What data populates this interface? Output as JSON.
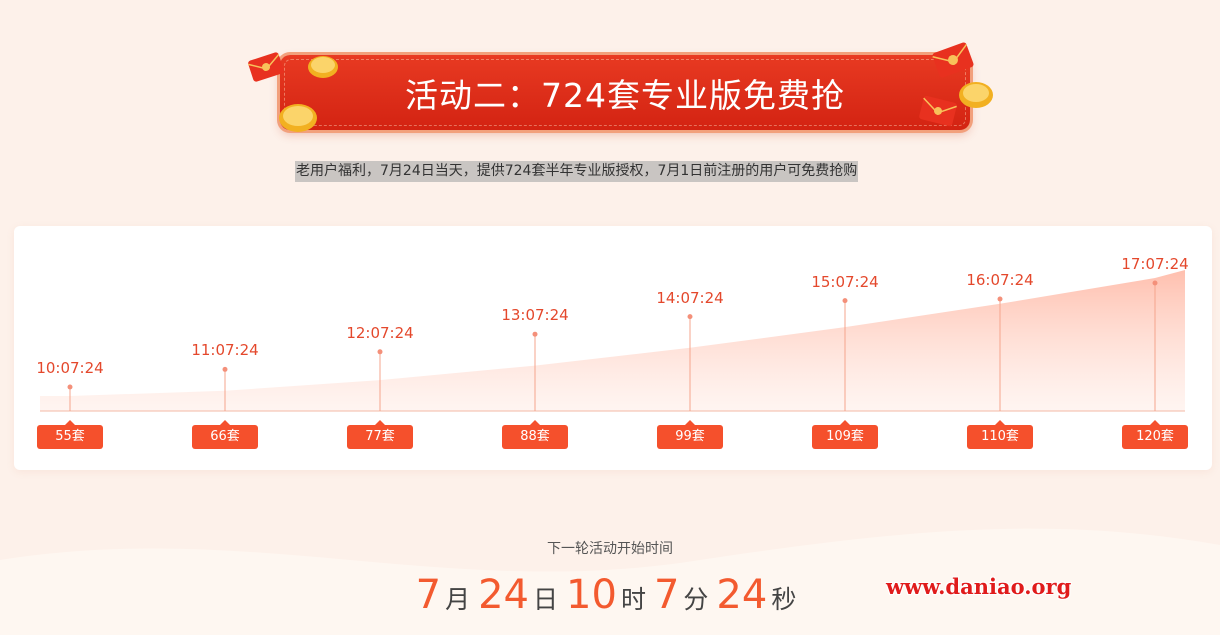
{
  "banner": {
    "title": "活动二：724套专业版免费抢"
  },
  "subtitle": "老用户福利，7月24日当天，提供724套半年专业版授权，7月1日前注册的用户可免费抢购",
  "icons": [
    "red-envelope-icon",
    "gold-coin-icon",
    "red-envelope-icon",
    "gold-coin-icon",
    "red-envelope-icon",
    "gold-coin-icon"
  ],
  "colors": {
    "accent": "#f5502c",
    "banner": "#d32312",
    "time_text": "#e4482c",
    "background": "#fdf1ea"
  },
  "chart_data": {
    "type": "area",
    "categories": [
      "10:07:24",
      "11:07:24",
      "12:07:24",
      "13:07:24",
      "14:07:24",
      "15:07:24",
      "16:07:24",
      "17:07:24"
    ],
    "values": [
      55,
      66,
      77,
      88,
      99,
      109,
      110,
      120
    ],
    "value_labels": [
      "55套",
      "66套",
      "77套",
      "88套",
      "99套",
      "109套",
      "110套",
      "120套"
    ],
    "unit": "套",
    "ylim": [
      0,
      130
    ],
    "grid": false
  },
  "countdown": {
    "label": "下一轮活动开始时间",
    "month": "7",
    "month_unit": "月",
    "day": "24",
    "day_unit": "日",
    "hour": "10",
    "hour_unit": "时",
    "minute": "7",
    "minute_unit": "分",
    "second": "24",
    "second_unit": "秒"
  },
  "watermark": "www.daniao.org"
}
